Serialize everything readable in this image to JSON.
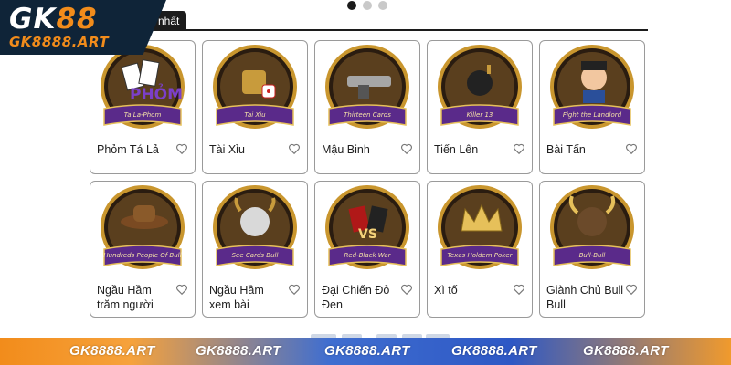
{
  "brand": {
    "logo_main_a": "GK",
    "logo_main_b": "88",
    "logo_sub": "GK8888.ART"
  },
  "tab": {
    "label": "nhất"
  },
  "games": [
    {
      "name": "Phỏm Tá Lả",
      "banner": "Ta La-Phom"
    },
    {
      "name": "Tài Xỉu",
      "banner": "Tai Xiu"
    },
    {
      "name": "Mậu Binh",
      "banner": "Thirteen Cards"
    },
    {
      "name": "Tiến Lên",
      "banner": "Killer 13"
    },
    {
      "name": "Bài Tấn",
      "banner": "Fight the Landlord"
    },
    {
      "name": "Ngầu Hầm trăm người",
      "banner": "Hundreds People Of Bull"
    },
    {
      "name": "Ngầu Hầm xem bài",
      "banner": "See Cards Bull"
    },
    {
      "name": "Đại Chiến Đỏ Đen",
      "banner": "Red-Black War"
    },
    {
      "name": "Xì tố",
      "banner": "Texas Holdem Poker"
    },
    {
      "name": "Giành Chủ Bull Bull",
      "banner": "Bull-Bull"
    }
  ],
  "footer": {
    "watermark": [
      "GK8888.ART",
      "GK8888.ART",
      "GK8888.ART",
      "GK8888.ART",
      "GK8888.ART"
    ]
  },
  "colors": {
    "orange": "#f28c1b",
    "navy": "#0f2438",
    "gold": "#c9962e",
    "purple": "#5a2a8a"
  }
}
